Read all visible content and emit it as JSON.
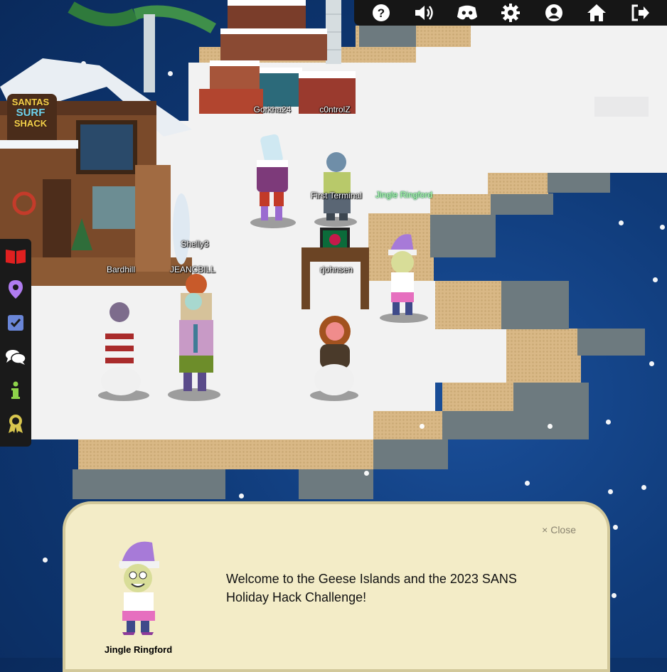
{
  "topbar": {
    "buttons": [
      {
        "name": "help-icon"
      },
      {
        "name": "volume-icon"
      },
      {
        "name": "discord-icon"
      },
      {
        "name": "settings-gear-icon"
      },
      {
        "name": "account-icon"
      },
      {
        "name": "home-icon"
      },
      {
        "name": "logout-icon"
      }
    ]
  },
  "sidebar": {
    "buttons": [
      {
        "name": "book-icon",
        "color": "#e02020"
      },
      {
        "name": "map-pin-icon",
        "color": "#b07cf0"
      },
      {
        "name": "checklist-icon",
        "color": "#6a86d8"
      },
      {
        "name": "chat-icon",
        "color": "#ffffff"
      },
      {
        "name": "info-icon",
        "color": "#8ed34a"
      },
      {
        "name": "badge-icon",
        "color": "#d8c64e"
      }
    ]
  },
  "scene": {
    "shack_sign": [
      "SANTAS",
      "SURF",
      "SHACK"
    ],
    "players": {
      "gorkha": "Gorkha24",
      "c0ntrol": "c0ntrolZ",
      "first_terminal": "First Terminal",
      "jingle": "Jingle Ringford",
      "shelly": "Shelly3",
      "bardhill": "Bardhill",
      "jeancbill": "JEANCBILL",
      "rjohnsen": "rjohnsen"
    }
  },
  "dialog": {
    "close_label": "× Close",
    "message": "Welcome to the Geese Islands and the 2023 SANS Holiday Hack Challenge!",
    "npc_name": "Jingle Ringford"
  },
  "colors": {
    "sea": "#0f3a78",
    "sand": "#d9b886",
    "snow": "#f2f2f2",
    "dialog_bg": "#f3ecc7",
    "toolbar_bg": "#161616"
  }
}
